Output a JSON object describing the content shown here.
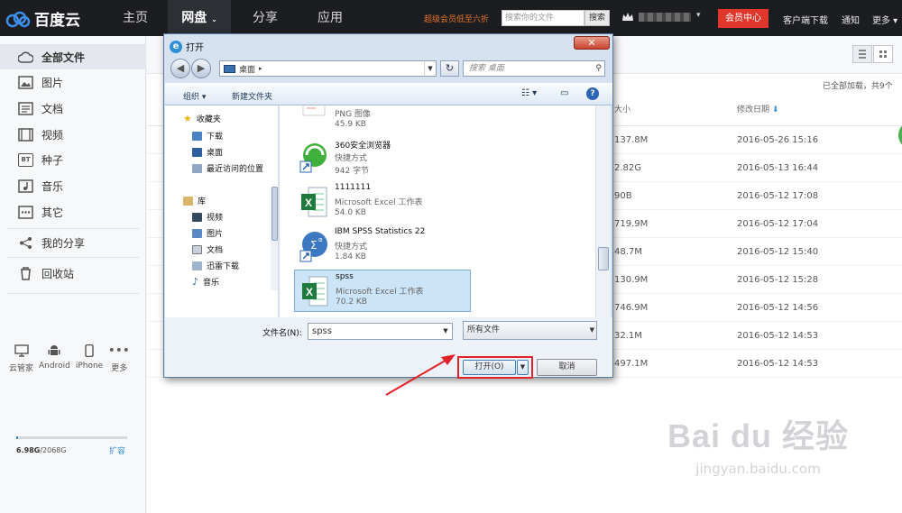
{
  "topbar": {
    "logo": "百度云",
    "nav": [
      "主页",
      "网盘",
      "分享",
      "应用"
    ],
    "promo": "超级会员低至六折",
    "search_placeholder": "搜索你的文件",
    "search_btn": "搜索",
    "vip": "会员中心",
    "right": [
      "客户端下载",
      "通知",
      "更多"
    ]
  },
  "sidebar": {
    "items": [
      {
        "label": "全部文件",
        "icon": "cloud-icon"
      },
      {
        "label": "图片",
        "icon": "image-icon"
      },
      {
        "label": "文档",
        "icon": "document-icon"
      },
      {
        "label": "视频",
        "icon": "video-icon"
      },
      {
        "label": "种子",
        "icon": "bt-icon",
        "glyph": "BT"
      },
      {
        "label": "音乐",
        "icon": "music-icon"
      },
      {
        "label": "其它",
        "icon": "other-icon"
      },
      {
        "label": "我的分享",
        "icon": "share-icon"
      },
      {
        "label": "回收站",
        "icon": "trash-icon"
      }
    ],
    "devices": [
      "云管家",
      "Android",
      "iPhone",
      "更多"
    ],
    "quota_used": "6.98G",
    "quota_total": "/2068G",
    "quota_fraction": 0.0034,
    "expand": "扩容"
  },
  "main": {
    "loaded": "已全部加载，共9个",
    "col_size": "大小",
    "col_date": "修改日期",
    "rows": [
      {
        "size": "137.8M",
        "date": "2016-05-26 15:16"
      },
      {
        "size": "2.82G",
        "date": "2016-05-13 16:44"
      },
      {
        "size": "90B",
        "date": "2016-05-12 17:08"
      },
      {
        "size": "719.9M",
        "date": "2016-05-12 17:04"
      },
      {
        "size": "48.7M",
        "date": "2016-05-12 15:40"
      },
      {
        "size": "130.9M",
        "date": "2016-05-12 15:28"
      },
      {
        "size": "746.9M",
        "date": "2016-05-12 14:56"
      },
      {
        "size": "32.1M",
        "date": "2016-05-12 14:53"
      },
      {
        "size": "497.1M",
        "date": "2016-05-12 14:53"
      }
    ]
  },
  "dialog": {
    "title": "打开",
    "close": "✕",
    "path": "桌面",
    "search_placeholder": "搜索 桌面",
    "organize": "组织 ▾",
    "new_folder": "新建文件夹",
    "nav": {
      "favorites": "收藏夹",
      "downloads": "下载",
      "desktop": "桌面",
      "recent": "最近访问的位置",
      "library": "库",
      "videos": "视频",
      "pictures": "图片",
      "documents": "文档",
      "thunder": "迅雷下载",
      "music": "音乐"
    },
    "files": [
      {
        "name": "",
        "type": "PNG 图像",
        "size": "45.9 KB",
        "icon": "png-icon"
      },
      {
        "name": "360安全浏览器",
        "type": "快捷方式",
        "size": "942 字节",
        "icon": "browser-360-icon"
      },
      {
        "name": "1111111",
        "type": "Microsoft Excel 工作表",
        "size": "54.0 KB",
        "icon": "excel-icon"
      },
      {
        "name": "IBM SPSS Statistics 22",
        "type": "快捷方式",
        "size": "1.84 KB",
        "icon": "spss-icon"
      },
      {
        "name": "spss",
        "type": "Microsoft Excel 工作表",
        "size": "70.2 KB",
        "icon": "excel-icon"
      }
    ],
    "filename_label": "文件名(N):",
    "filename_value": "spss",
    "filetype": "所有文件",
    "open_btn": "打开(O)",
    "cancel_btn": "取消"
  },
  "watermark": {
    "big": "Bai du 经验",
    "small": "jingyan.baidu.com"
  },
  "colors": {
    "accent_red": "#e0372d",
    "topbar": "#1b1d21",
    "link_blue": "#3b8cd9"
  }
}
